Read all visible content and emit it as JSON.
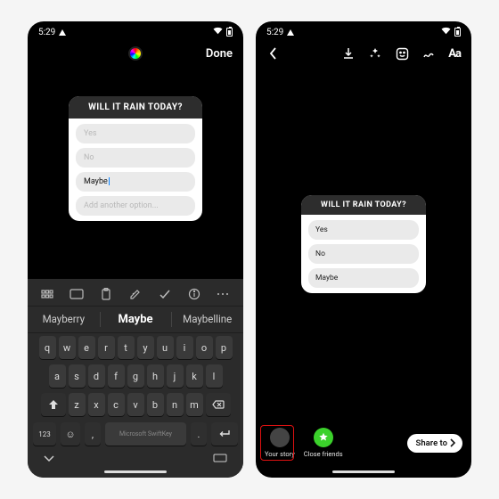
{
  "status": {
    "time": "5:29"
  },
  "left": {
    "done_label": "Done",
    "quiz": {
      "question": "WILL IT RAIN TODAY?",
      "options": [
        "Yes",
        "No",
        "Maybe"
      ],
      "placeholder": "Add another option...",
      "active_index": 2
    },
    "suggestions": [
      "Mayberry",
      "Maybe",
      "Maybelline"
    ],
    "keyboard": {
      "rows": [
        [
          "q",
          "w",
          "e",
          "r",
          "t",
          "y",
          "u",
          "i",
          "o",
          "p"
        ],
        [
          "a",
          "s",
          "d",
          "f",
          "g",
          "h",
          "j",
          "k",
          "l"
        ],
        [
          "z",
          "x",
          "c",
          "v",
          "b",
          "n",
          "m"
        ]
      ],
      "space_label": "Microsoft SwiftKey",
      "num_label": "123"
    }
  },
  "right": {
    "quiz": {
      "question": "WILL IT RAIN TODAY?",
      "options": [
        "Yes",
        "No",
        "Maybe"
      ]
    },
    "share": {
      "your_story": "Your story",
      "close_friends": "Close friends",
      "share_to": "Share to"
    }
  }
}
